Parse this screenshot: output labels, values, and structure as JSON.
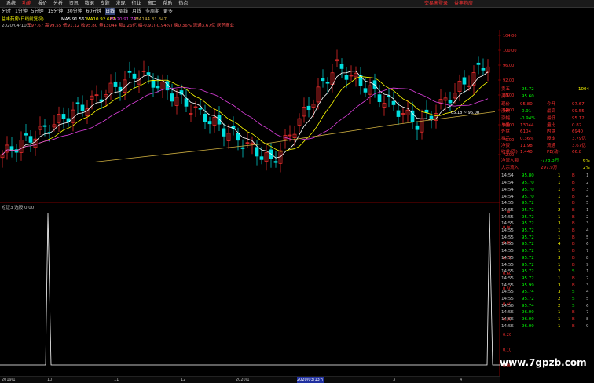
{
  "menu": [
    "系统",
    "功能",
    "报价",
    "分析",
    "资讯",
    "数据",
    "专题",
    "发现",
    "行业",
    "窗口",
    "帮助",
    "热点"
  ],
  "top_links": [
    "交易未登录",
    "益丰药房"
  ],
  "periods": [
    "分时",
    "1分钟",
    "5分钟",
    "15分钟",
    "30分钟",
    "60分钟",
    "日线",
    "周线",
    "月线",
    "多周期",
    "更多"
  ],
  "chart_info": {
    "title": "益丰药房(日线前复权)",
    "ma_labels": [
      "MA5 91.561",
      "MA10 92.687",
      "MA20 91.741",
      "MA144 81.847"
    ],
    "date_label": "2020/04/10五",
    "ohlc_text": "开97.67 高99.55 低91.12 收95.80 量13044 额1.26亿 幅-0.91(-0.94%) 换0.36% 流通3.67亿 医药商业",
    "price_labels": [
      "104.00",
      "100.00",
      "96.00",
      "92.00",
      "88.00",
      "84.00",
      "80.00",
      "76.00",
      "72.00"
    ],
    "crosshair_label": "05.18 ~ 96.00"
  },
  "indicator": {
    "title": "短证3 选股 0.00",
    "y_labels": [
      "1.00",
      "0.90",
      "0.80",
      "0.70",
      "0.60",
      "0.50",
      "0.40",
      "0.30",
      "0.20",
      "0.10",
      "0.00"
    ],
    "dates": [
      "2019/1",
      "10",
      "11",
      "12",
      "2020/1",
      "2020/03/13五",
      "3",
      "4"
    ]
  },
  "quote": {
    "top": [
      [
        "卖五",
        "95.72",
        "1004"
      ],
      [
        "买五",
        "95.60",
        ""
      ]
    ],
    "rows": [
      [
        "现价",
        "95.80",
        "今开",
        "97.67"
      ],
      [
        "涨跌",
        "-0.91",
        "最高",
        "99.55"
      ],
      [
        "涨幅",
        "-0.94%",
        "最低",
        "95.12"
      ],
      [
        "总量",
        "13044",
        "量比",
        "0.82"
      ],
      [
        "外盘",
        "6104",
        "内盘",
        "6940"
      ],
      [
        "换手",
        "0.36%",
        "股本",
        "3.79亿"
      ],
      [
        "净资",
        "11.98",
        "流通",
        "3.67亿"
      ],
      [
        "收益(四)",
        "1.440",
        "PE(动)",
        "66.8"
      ]
    ],
    "flow": [
      [
        "净流入额",
        "-778.3万",
        "6%"
      ],
      [
        "大宗流入",
        "297.9万",
        "2%"
      ]
    ],
    "ticks": [
      [
        "14:54",
        "95.80",
        "1",
        "B",
        "1"
      ],
      [
        "14:54",
        "95.70",
        "1",
        "B",
        "2"
      ],
      [
        "14:54",
        "95.70",
        "1",
        "B",
        "3"
      ],
      [
        "14:54",
        "95.70",
        "1",
        "B",
        "4"
      ],
      [
        "14:55",
        "95.72",
        "1",
        "B",
        "5"
      ],
      [
        "14:55",
        "95.72",
        "2",
        "B",
        "1"
      ],
      [
        "14:55",
        "95.72",
        "1",
        "B",
        "2"
      ],
      [
        "14:55",
        "95.72",
        "3",
        "B",
        "3"
      ],
      [
        "14:55",
        "95.72",
        "1",
        "B",
        "4"
      ],
      [
        "14:55",
        "95.72",
        "1",
        "B",
        "5"
      ],
      [
        "14:55",
        "95.72",
        "4",
        "B",
        "6"
      ],
      [
        "14:55",
        "95.72",
        "1",
        "B",
        "7"
      ],
      [
        "14:55",
        "95.72",
        "3",
        "B",
        "8"
      ],
      [
        "14:55",
        "95.72",
        "1",
        "B",
        "9"
      ],
      [
        "14:55",
        "95.72",
        "2",
        "S",
        "1"
      ],
      [
        "14:55",
        "95.72",
        "1",
        "B",
        "2"
      ],
      [
        "14:55",
        "95.99",
        "3",
        "B",
        "3"
      ],
      [
        "14:55",
        "95.74",
        "3",
        "S",
        "4"
      ],
      [
        "14:55",
        "95.72",
        "2",
        "S",
        "5"
      ],
      [
        "14:56",
        "95.74",
        "2",
        "S",
        "6"
      ],
      [
        "14:56",
        "96.00",
        "1",
        "B",
        "7"
      ],
      [
        "14:56",
        "96.00",
        "1",
        "B",
        "8"
      ],
      [
        "14:56",
        "96.00",
        "1",
        "B",
        "9"
      ]
    ]
  },
  "watermark": "www.7gpzb.com",
  "colors": {
    "up": "#ff3030",
    "down": "#00e0e0",
    "ma5": "#ffffff",
    "ma10": "#ffff00",
    "ma20": "#e040e0",
    "ma144": "#d0b040"
  }
}
